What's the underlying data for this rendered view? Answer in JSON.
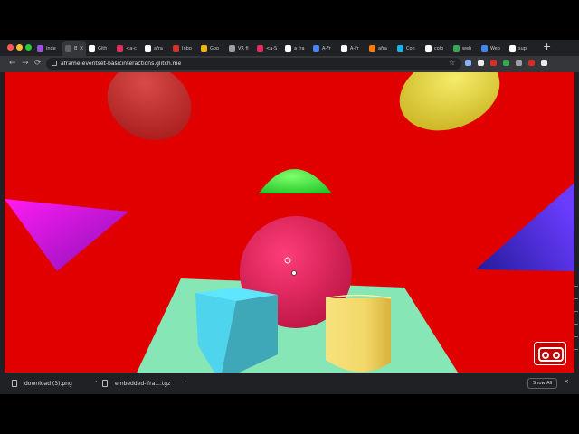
{
  "window": {
    "traffic_lights": [
      "#ff5f57",
      "#febc2e",
      "#28c840"
    ]
  },
  "tabs": [
    {
      "title": "inde",
      "icon": "stack-icon",
      "color": "#9b51e0"
    },
    {
      "title": "B",
      "icon": "page-icon",
      "color": "#5f6368",
      "active": true
    },
    {
      "title": "Gith",
      "icon": "github-icon",
      "color": "#ffffff"
    },
    {
      "title": "<a-c",
      "icon": "aframe-icon",
      "color": "#e8295c"
    },
    {
      "title": "afra",
      "icon": "github-icon",
      "color": "#ffffff"
    },
    {
      "title": "Inbo",
      "icon": "mail-icon",
      "color": "#d93025"
    },
    {
      "title": "Goo",
      "icon": "sheets-icon",
      "color": "#f4b400"
    },
    {
      "title": "VR fi",
      "icon": "vr-icon",
      "color": "#9aa0a6"
    },
    {
      "title": "<a-S",
      "icon": "aframe-icon",
      "color": "#e8295c"
    },
    {
      "title": "a fra",
      "icon": "github-icon",
      "color": "#ffffff"
    },
    {
      "title": "A-Fr",
      "icon": "discourse-icon",
      "color": "#4285f4"
    },
    {
      "title": "A-Fr",
      "icon": "github-icon",
      "color": "#ffffff"
    },
    {
      "title": "afra",
      "icon": "glitch-icon",
      "color": "#ff7c00"
    },
    {
      "title": "Con",
      "icon": "codepen-icon",
      "color": "#1bb3e6"
    },
    {
      "title": "colo",
      "icon": "github-icon",
      "color": "#ffffff"
    },
    {
      "title": "web",
      "icon": "drive-icon",
      "color": "#34a853"
    },
    {
      "title": "Web",
      "icon": "doc-icon",
      "color": "#4285f4"
    },
    {
      "title": "sup",
      "icon": "github-icon",
      "color": "#ffffff"
    }
  ],
  "newtab_label": "+",
  "tab_close_label": "×",
  "nav": {
    "back": "←",
    "forward": "→",
    "reload": "⟳"
  },
  "address_bar": {
    "url": "aframe-eventset-basicinteractions.glitch.me",
    "star": "☆"
  },
  "extensions": [
    {
      "icon": "camera-icon",
      "color": "#8ab4f8"
    },
    {
      "icon": "record-icon",
      "color": "#e8eaed"
    },
    {
      "icon": "block-icon",
      "color": "#d93025"
    },
    {
      "icon": "puzzle-icon",
      "color": "#34a853"
    },
    {
      "icon": "grid-icon",
      "color": "#9aa0a6"
    },
    {
      "icon": "lastpass-icon",
      "color": "#d32d27"
    },
    {
      "icon": "menu-dots-icon",
      "color": "#e8eaed"
    }
  ],
  "scene": {
    "background": "#e00000",
    "objects": [
      {
        "name": "red-ellipsoid",
        "color": "#c42424"
      },
      {
        "name": "yellow-ellipsoid",
        "color": "#e6d43a"
      },
      {
        "name": "magenta-triangle",
        "color": "#d21ce0"
      },
      {
        "name": "blue-triangle",
        "color": "#3f2ad0"
      },
      {
        "name": "pink-sphere",
        "color": "#e8245c"
      },
      {
        "name": "green-dome",
        "color": "#3cf040"
      },
      {
        "name": "teal-plane",
        "color": "#86e6b6"
      },
      {
        "name": "cyan-box",
        "color": "#4fd4ee"
      },
      {
        "name": "yellow-cylinder",
        "color": "#f3d868"
      }
    ],
    "cursor": {
      "color": "#ffffff"
    },
    "vr_button": {
      "icon": "vr-goggles-icon"
    }
  },
  "downloads": {
    "items": [
      {
        "name": "download (3).png",
        "caret": "^"
      },
      {
        "name": "embedded-ifra....tgz",
        "caret": "^"
      }
    ],
    "show_all_label": "Show All",
    "close_label": "×"
  }
}
